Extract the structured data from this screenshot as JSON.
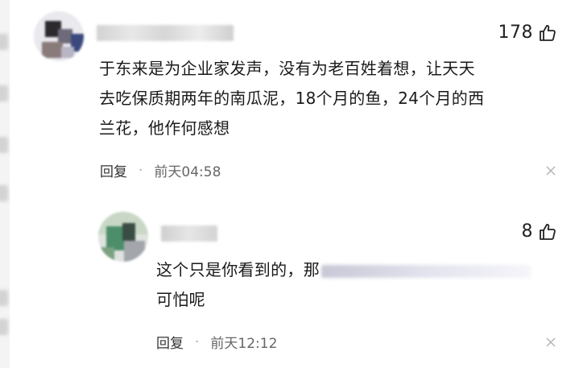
{
  "comments": [
    {
      "like_count": "178",
      "text_lines": [
        "于东来是为企业家发声，没有为老百姓着想，让天天",
        "去吃保质期两年的南瓜泥，18个月的鱼，24个月的西",
        "兰花，他作何感想"
      ],
      "reply_label": "回复",
      "separator": "·",
      "time": "前天04:58",
      "icons": {
        "like": "thumbs-up-icon",
        "close": "close-icon"
      }
    },
    {
      "like_count": "8",
      "text_lines": [
        "这个只是你看到的，那",
        "可怕呢"
      ],
      "reply_label": "回复",
      "separator": "·",
      "time": "前天12:12",
      "icons": {
        "like": "thumbs-up-icon",
        "close": "close-icon"
      }
    }
  ]
}
